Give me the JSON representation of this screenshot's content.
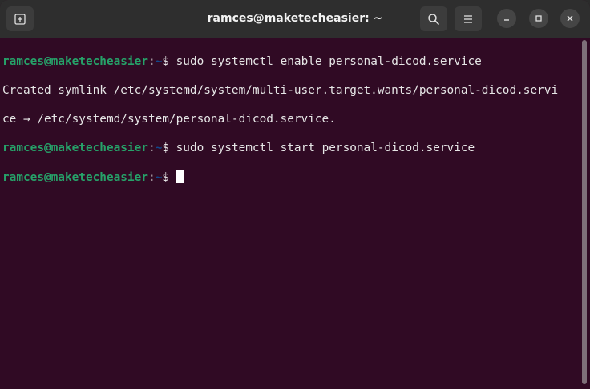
{
  "window": {
    "title": "ramces@maketecheasier: ~"
  },
  "header": {
    "new_tab_icon": "new-tab-icon",
    "search_icon": "search-icon",
    "menu_icon": "hamburger-menu-icon",
    "minimize_icon": "minimize-icon",
    "maximize_icon": "maximize-icon",
    "close_icon": "close-icon"
  },
  "colors": {
    "background": "#300a24",
    "prompt_user": "#26a269",
    "prompt_path": "#12488b",
    "text": "#e6e6e6"
  },
  "terminal": {
    "prompt_user": "ramces@maketecheasier",
    "prompt_sep": ":",
    "prompt_path": "~",
    "prompt_symbol": "$",
    "command1": " sudo systemctl enable personal-dicod.service",
    "output1": "Created symlink /etc/systemd/system/multi-user.target.wants/personal-dicod.servi",
    "output2": "ce → /etc/systemd/system/personal-dicod.service.",
    "command2": " sudo systemctl start personal-dicod.service",
    "command3": " "
  }
}
